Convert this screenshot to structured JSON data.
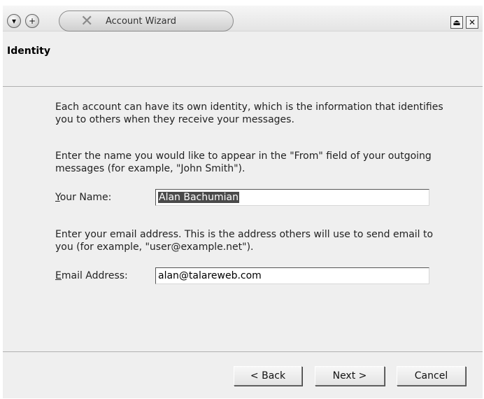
{
  "window": {
    "title": "Account Wizard",
    "menu_icon": "circle-down-arrow-icon",
    "pin_icon": "circle-plus-icon",
    "app_icon": "x-logo-icon",
    "maximize_icon": "eject-up-icon",
    "close_icon": "close-x-icon"
  },
  "page": {
    "title": "Identity"
  },
  "content": {
    "intro": "Each account can have its own identity, which is the information that identifies you to others when they receive your messages.",
    "name_prompt": "Enter the name you would like to appear in the \"From\" field of your outgoing messages (for example, \"John Smith\").",
    "name_label_underlined": "Y",
    "name_label_rest": "our Name:",
    "name_value": "Alan Bachumian",
    "email_prompt": "Enter your email address. This is the address others will use to send email to you (for example, \"user@example.net\").",
    "email_label_underlined": "E",
    "email_label_rest": "mail Address:",
    "email_value": "alan@talareweb.com"
  },
  "buttons": {
    "back": "< Back",
    "next": "Next >",
    "cancel": "Cancel"
  }
}
